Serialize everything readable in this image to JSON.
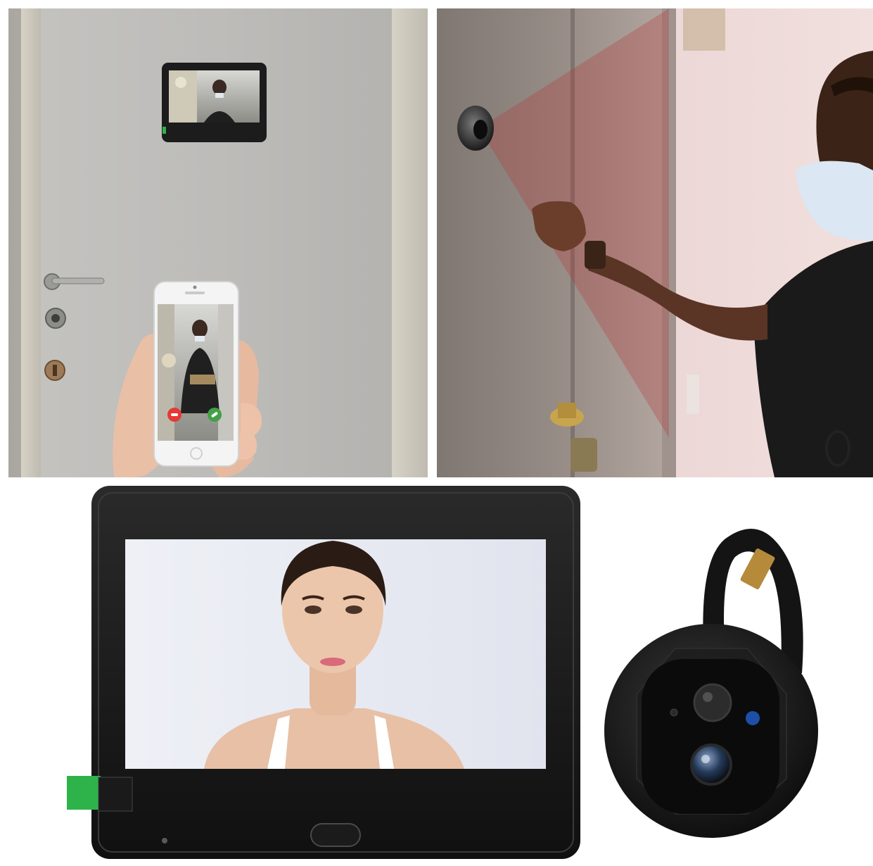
{
  "image": {
    "panels": [
      {
        "name": "door-scene"
      },
      {
        "name": "knock-scene"
      },
      {
        "name": "product-scene"
      }
    ]
  },
  "icons": {
    "call_decline": "phone-decline-icon",
    "call_accept": "phone-accept-icon",
    "home_button": "home-button-icon"
  },
  "colors": {
    "door": "#b9b8b4",
    "monitor_bezel": "#161616",
    "peephole_camera": "#1a1a1a",
    "decline_red": "#e53935",
    "accept_green": "#43a047",
    "protective_tab": "#2eb34a",
    "ir_led_blue": "#1e4fa8",
    "field_of_view_red": "#b43c3c"
  }
}
